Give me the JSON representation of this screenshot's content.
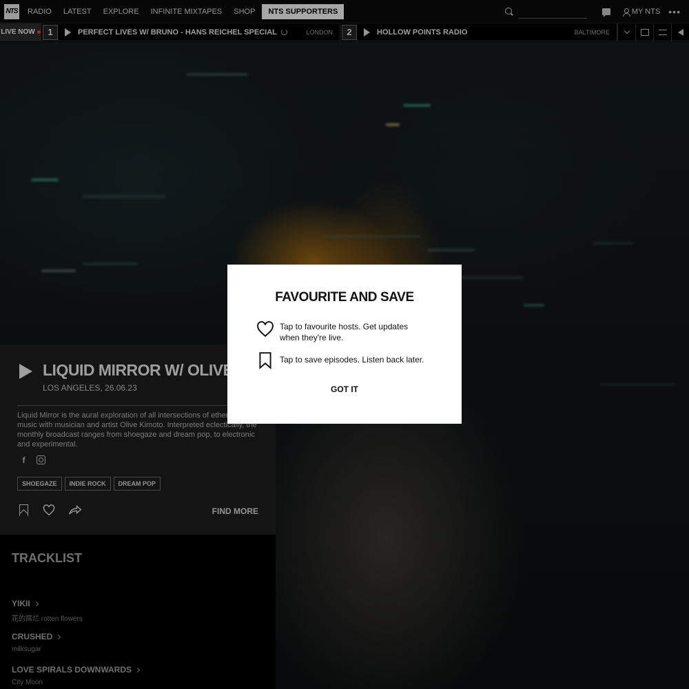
{
  "nav": {
    "logo_text": "NTS",
    "items": [
      "RADIO",
      "LATEST",
      "EXPLORE",
      "INFINITE MIXTAPES",
      "SHOP"
    ],
    "supporters_label": "NTS SUPPORTERS",
    "my_nts_label": "MY NTS",
    "more_label": "•••"
  },
  "live_bar": {
    "live_label": "LIVE NOW",
    "channels": [
      {
        "number": "1",
        "title": "PERFECT LIVES W/ BRUNO - HANS REICHEL SPECIAL",
        "location": "LONDON"
      },
      {
        "number": "2",
        "title": "HOLLOW POINTS RADIO",
        "location": "BALTIMORE"
      }
    ]
  },
  "show": {
    "title": "LIQUID MIRROR W/ OLIVE KIMOTO",
    "subtitle": "LOS ANGELES, 26.06.23",
    "description": "Liquid Mirror is the aural exploration of all intersections of ethereal music with musician and artist Olive Kimoto. Interpreted eclectically, the monthly broadcast ranges from shoegaze and dream pop, to electronic and experimental.",
    "tags": [
      "SHOEGAZE",
      "INDIE ROCK",
      "DREAM POP"
    ],
    "find_more_label": "FIND MORE",
    "facebook_glyph": "f"
  },
  "tracklist": {
    "heading": "TRACKLIST",
    "tracks": [
      {
        "title": "YIKII",
        "artist": "花的腐烂 rotten flowers"
      },
      {
        "title": "CRUSHED",
        "artist": "milksugar"
      },
      {
        "title": "LOVE SPIRALS DOWNWARDS",
        "artist": "City Moon"
      }
    ]
  },
  "modal": {
    "title": "FAVOURITE AND SAVE",
    "favourite_text": "Tap to favourite hosts. Get updates when they're live.",
    "save_text": "Tap to save episodes. Listen back later.",
    "button_label": "GOT IT"
  }
}
